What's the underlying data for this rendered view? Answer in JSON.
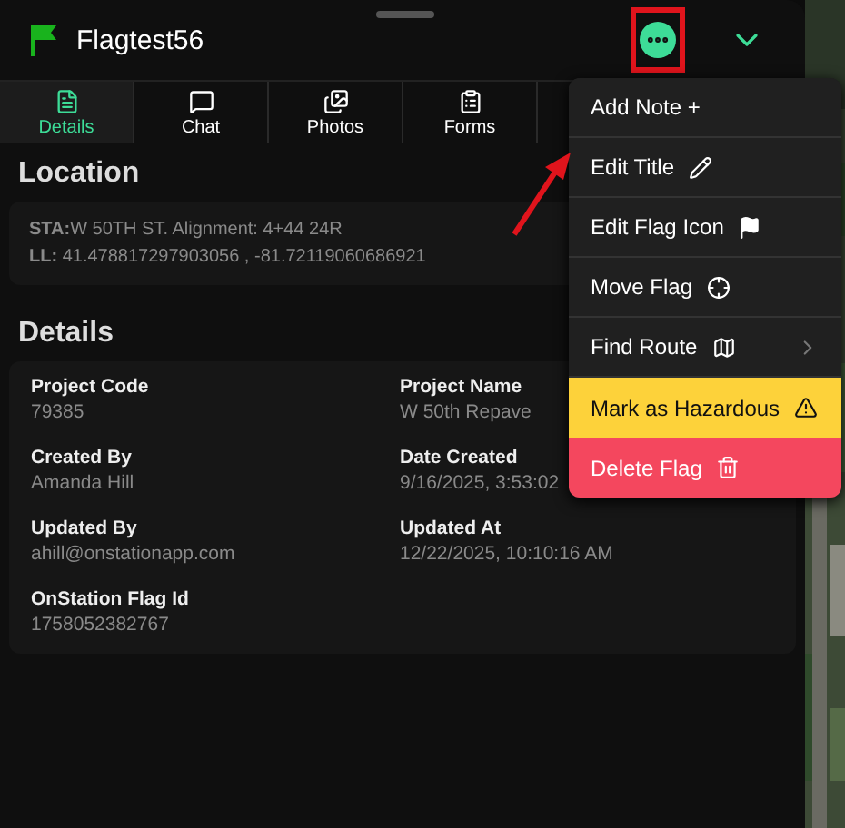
{
  "header": {
    "title": "Flagtest56"
  },
  "tabs": [
    {
      "label": "Details",
      "selected": true
    },
    {
      "label": "Chat",
      "selected": false
    },
    {
      "label": "Photos",
      "selected": false
    },
    {
      "label": "Forms",
      "selected": false
    }
  ],
  "location": {
    "heading": "Location",
    "station_label": "STA:",
    "station": "W 50TH ST. Alignment: 4+44 24R",
    "ll_label": "LL:",
    "ll": "41.478817297903056 , -81.72119060686921"
  },
  "details": {
    "heading": "Details",
    "fields": [
      {
        "label": "Project Code",
        "value": "79385"
      },
      {
        "label": "Project Name",
        "value": "W 50th Repave"
      },
      {
        "label": "Created By",
        "value": "Amanda Hill"
      },
      {
        "label": "Date Created",
        "value": "9/16/2025, 3:53:02"
      },
      {
        "label": "Updated By",
        "value": "ahill@onstationapp.com"
      },
      {
        "label": "Updated At",
        "value": "12/22/2025, 10:10:16 AM"
      },
      {
        "label": "OnStation Flag Id",
        "value": "1758052382767"
      }
    ]
  },
  "menu": [
    {
      "label": "Add Note +",
      "kind": "plain"
    },
    {
      "label": "Edit Title",
      "kind": "plain"
    },
    {
      "label": "Edit Flag Icon",
      "kind": "plain"
    },
    {
      "label": "Move Flag",
      "kind": "plain"
    },
    {
      "label": "Find Route",
      "kind": "plain",
      "submenu": true
    },
    {
      "label": "Mark as Hazardous",
      "kind": "hazard"
    },
    {
      "label": "Delete Flag",
      "kind": "danger"
    }
  ]
}
